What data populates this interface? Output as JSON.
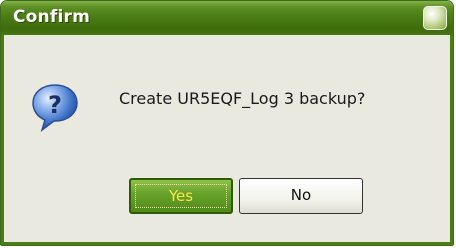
{
  "window": {
    "title": "Confirm"
  },
  "dialog": {
    "icon": "question-icon",
    "message": "Create UR5EQF_Log 3 backup?"
  },
  "buttons": {
    "yes_label": "Yes",
    "no_label": "No"
  },
  "colors": {
    "titlebar": "#4c7d15",
    "body": "#e9e9df",
    "yes_button": "#69a42c",
    "yes_text": "#ffe34a"
  }
}
